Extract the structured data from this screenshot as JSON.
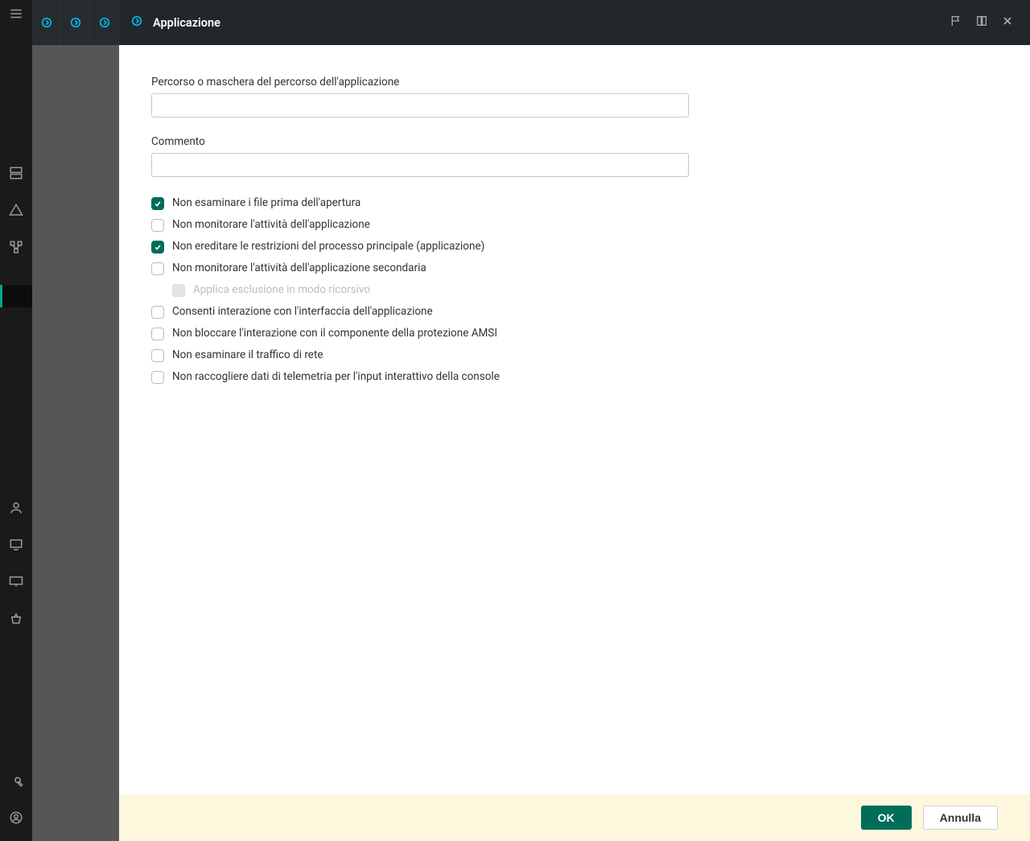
{
  "header": {
    "title": "Applicazione"
  },
  "form": {
    "path_label": "Percorso o maschera del percorso dell'applicazione",
    "path_value": "",
    "comment_label": "Commento",
    "comment_value": ""
  },
  "checks": {
    "c1": {
      "label": "Non esaminare i file prima dell'apertura",
      "checked": true
    },
    "c2": {
      "label": "Non monitorare l'attività dell'applicazione",
      "checked": false
    },
    "c3": {
      "label": "Non ereditare le restrizioni del processo principale (applicazione)",
      "checked": true
    },
    "c4": {
      "label": "Non monitorare l'attività dell'applicazione secondaria",
      "checked": false
    },
    "c4a": {
      "label": "Applica esclusione in modo ricorsivo",
      "checked": false
    },
    "c5": {
      "label": "Consenti interazione con l'interfaccia dell'applicazione",
      "checked": false
    },
    "c6": {
      "label": "Non bloccare l'interazione con il componente della protezione AMSI",
      "checked": false
    },
    "c7": {
      "label": "Non esaminare il traffico di rete",
      "checked": false
    },
    "c8": {
      "label": "Non raccogliere dati di telemetria per l'input interattivo della console",
      "checked": false
    }
  },
  "footer": {
    "ok": "OK",
    "cancel": "Annulla"
  }
}
